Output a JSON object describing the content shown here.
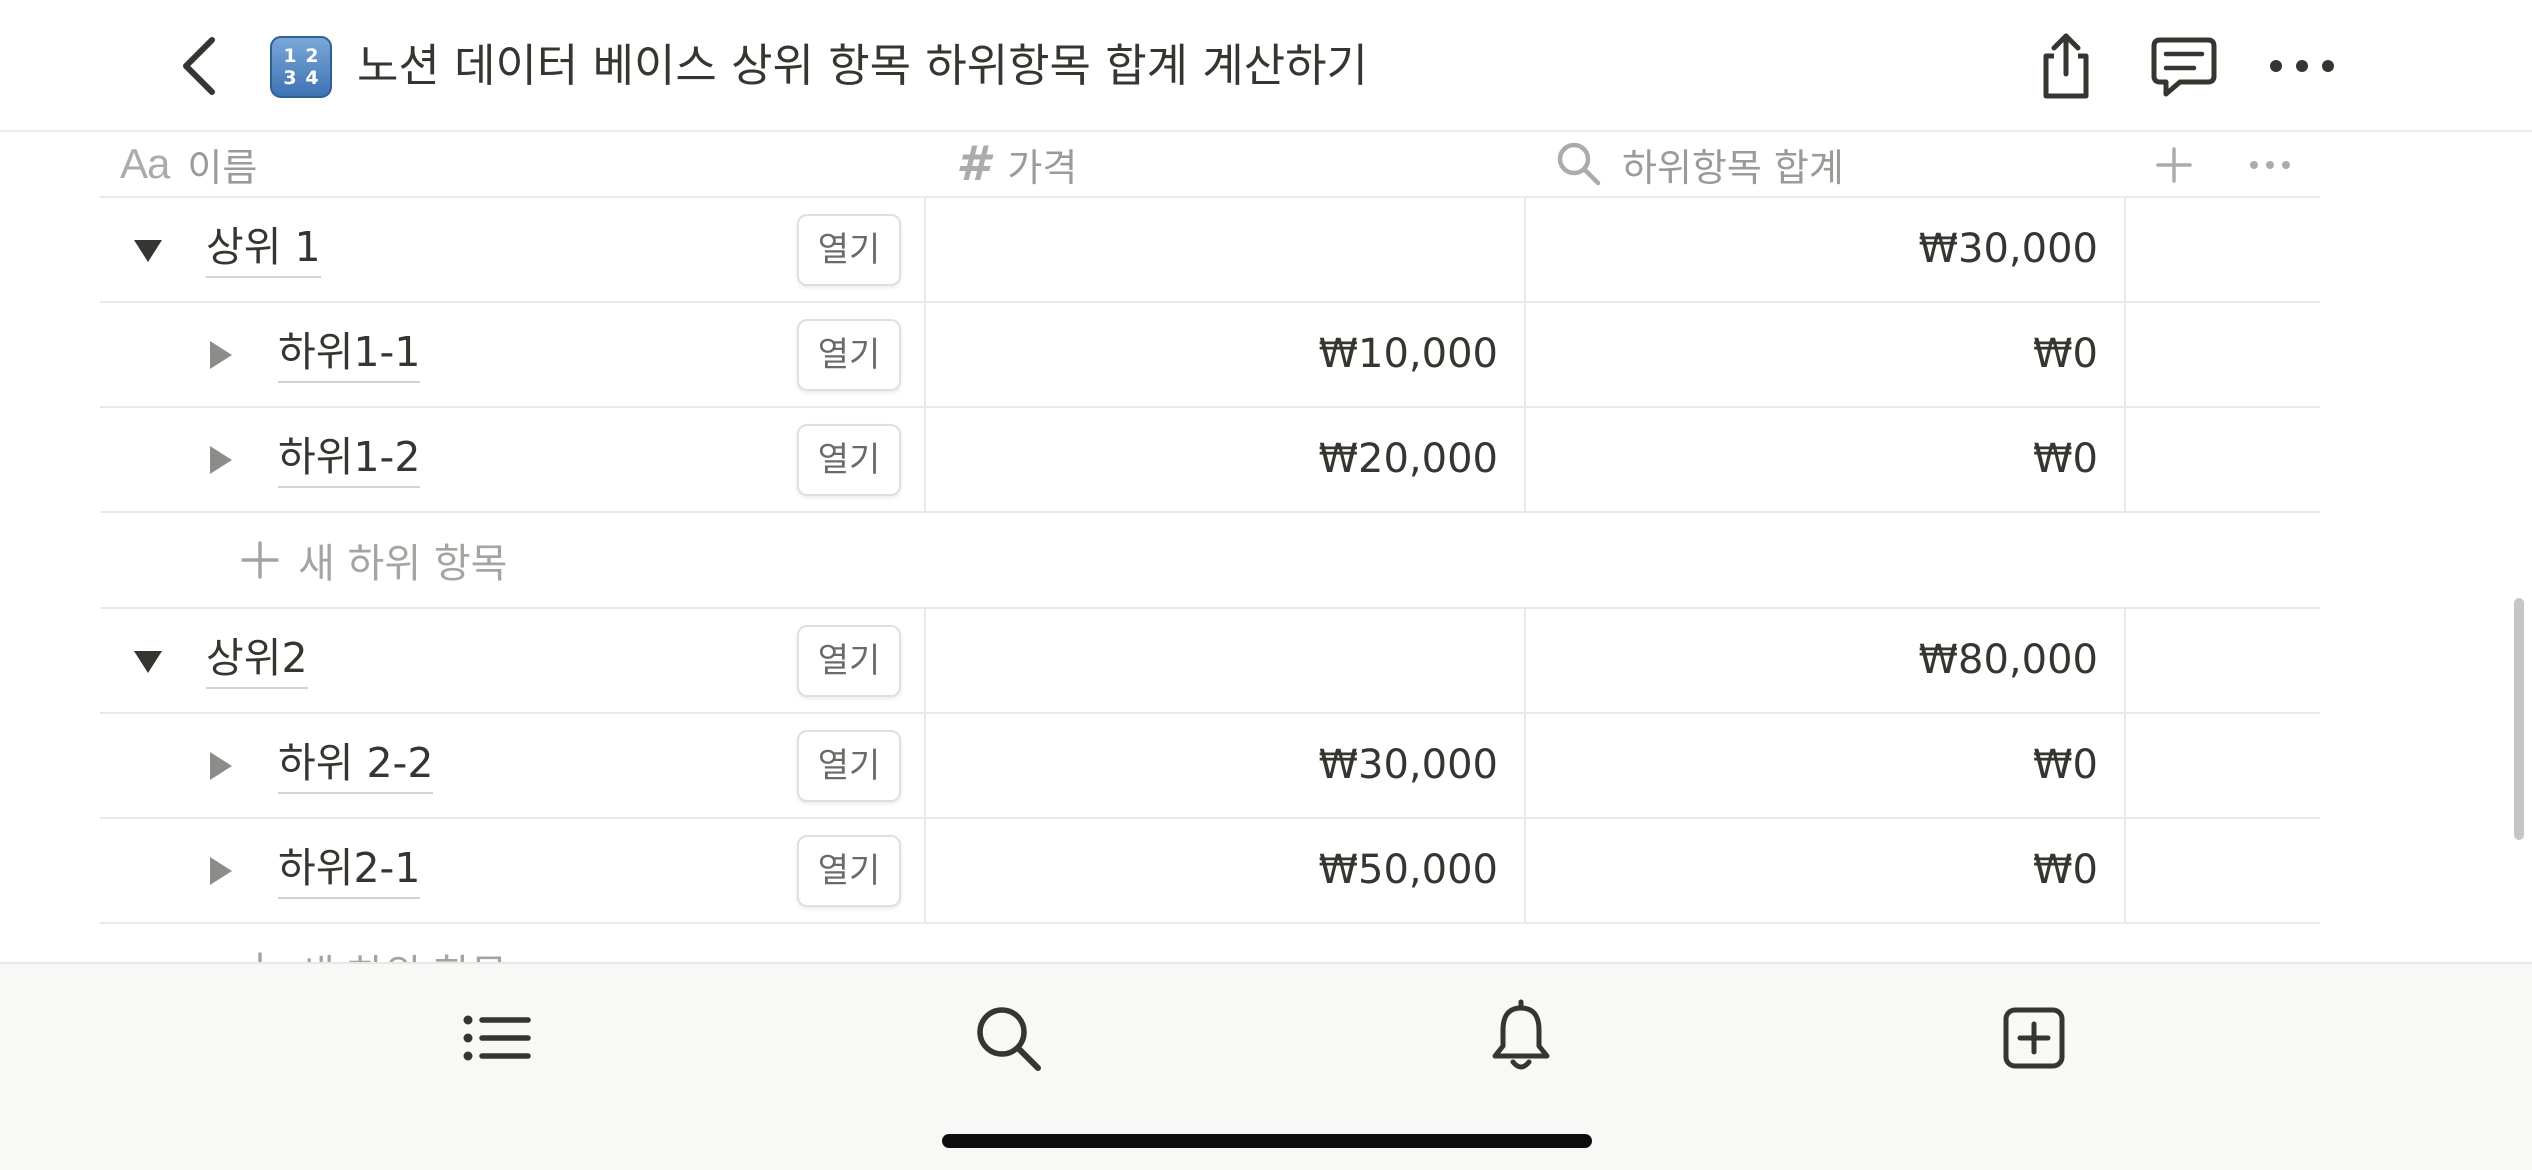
{
  "topbar": {
    "page_emoji_digits": [
      "1",
      "2",
      "3",
      "4"
    ],
    "title": "노션 데이터 베이스 상위 항목 하위항목 합계 계산하기",
    "icons": [
      "back-icon",
      "share-icon",
      "comment-icon",
      "more-icon"
    ]
  },
  "table": {
    "columns": [
      {
        "icon": "Aa",
        "label": "이름"
      },
      {
        "icon": "#",
        "label": "가격"
      },
      {
        "icon": "search-icon",
        "label": "하위항목 합계"
      }
    ],
    "open_label": "열기",
    "new_sub_label": "새 하위 항목",
    "groups": [
      {
        "parent": {
          "name": "상위 1",
          "price": "",
          "sum": "₩30,000",
          "expanded": true
        },
        "children": [
          {
            "name": "하위1-1",
            "price": "₩10,000",
            "sum": "₩0"
          },
          {
            "name": "하위1-2",
            "price": "₩20,000",
            "sum": "₩0"
          }
        ]
      },
      {
        "parent": {
          "name": "상위2",
          "price": "",
          "sum": "₩80,000",
          "expanded": true
        },
        "children": [
          {
            "name": "하위 2-2",
            "price": "₩30,000",
            "sum": "₩0"
          },
          {
            "name": "하위2-1",
            "price": "₩50,000",
            "sum": "₩0"
          }
        ]
      }
    ]
  },
  "bottombar": {
    "icons": [
      "list-icon",
      "search-icon",
      "bell-icon",
      "new-page-icon"
    ]
  },
  "colors": {
    "text": "#37352f",
    "muted": "#9b9a97",
    "border": "#e9e9e7",
    "bottom_bar_bg": "#f8f8f7"
  }
}
